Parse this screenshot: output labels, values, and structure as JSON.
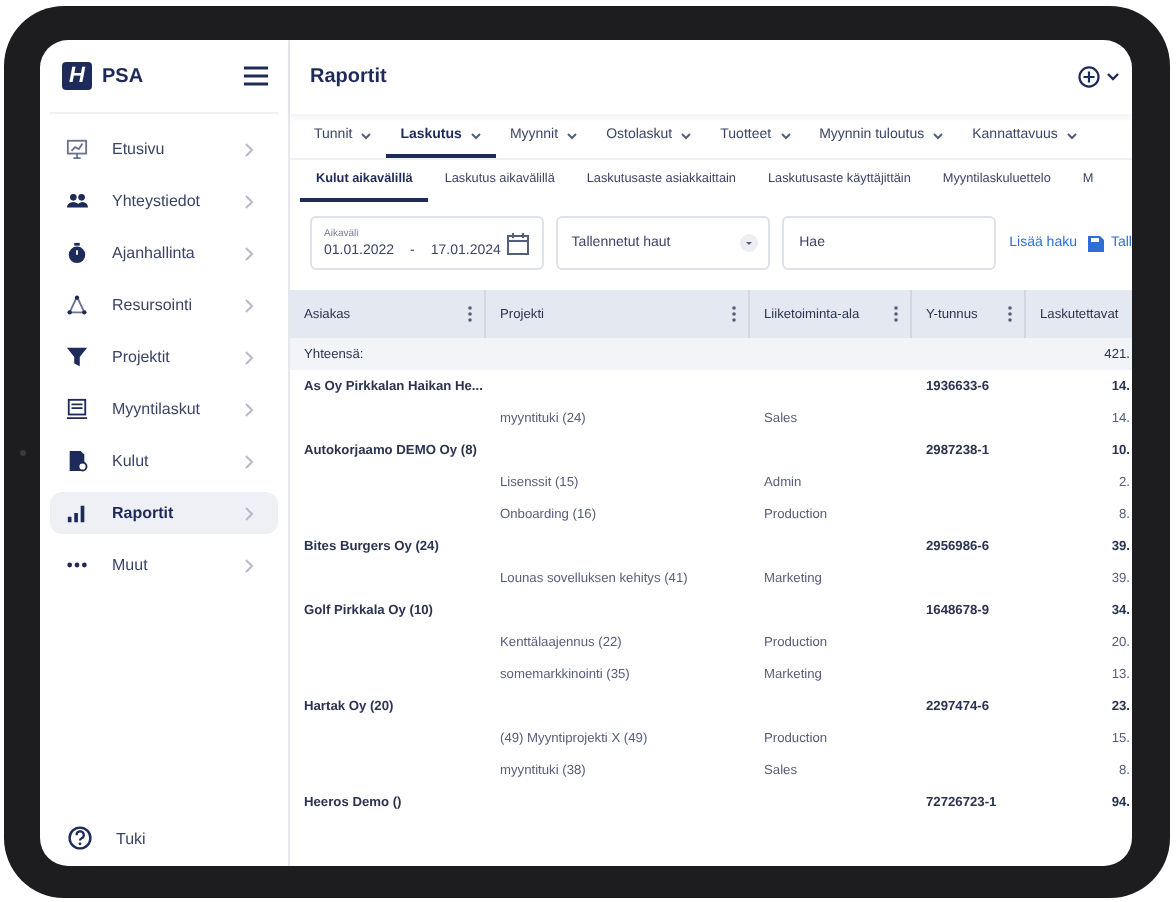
{
  "sidebar": {
    "logo_mark": "H",
    "brand": "PSA",
    "items": [
      {
        "label": "Etusivu",
        "selected": false
      },
      {
        "label": "Yhteystiedot",
        "selected": false
      },
      {
        "label": "Ajanhallinta",
        "selected": false
      },
      {
        "label": "Resursointi",
        "selected": false
      },
      {
        "label": "Projektit",
        "selected": false
      },
      {
        "label": "Myyntilaskut",
        "selected": false
      },
      {
        "label": "Kulut",
        "selected": false
      },
      {
        "label": "Raportit",
        "selected": true
      },
      {
        "label": "Muut",
        "selected": false
      }
    ],
    "help": "Tuki"
  },
  "header": {
    "title": "Raportit"
  },
  "tabs": [
    {
      "label": "Tunnit",
      "selected": false
    },
    {
      "label": "Laskutus",
      "selected": true
    },
    {
      "label": "Myynnit",
      "selected": false
    },
    {
      "label": "Ostolaskut",
      "selected": false
    },
    {
      "label": "Tuotteet",
      "selected": false
    },
    {
      "label": "Myynnin tuloutus",
      "selected": false
    },
    {
      "label": "Kannattavuus",
      "selected": false
    }
  ],
  "subtabs": [
    {
      "label": "Kulut aikavälillä",
      "selected": true
    },
    {
      "label": "Laskutus aikavälillä",
      "selected": false
    },
    {
      "label": "Laskutusaste asiakkaittain",
      "selected": false
    },
    {
      "label": "Laskutusaste käyttäjittäin",
      "selected": false
    },
    {
      "label": "Myyntilaskuluettelo",
      "selected": false
    },
    {
      "label": "M",
      "selected": false
    }
  ],
  "filters": {
    "date_range": {
      "label": "Aikaväli",
      "start": "01.01.2022",
      "separator": "-",
      "end": "17.01.2024"
    },
    "saved_searches": {
      "value": "Tallennetut haut"
    },
    "search": {
      "placeholder": "Hae"
    },
    "add_search": "Lisää haku",
    "save": "Tall"
  },
  "table": {
    "columns": [
      "Asiakas",
      "Projekti",
      "Liiketoiminta-ala",
      "Y-tunnus",
      "Laskutettavat"
    ],
    "rows": [
      {
        "kind": "total",
        "customer": "Yhteensä:",
        "value": "421."
      },
      {
        "kind": "customer",
        "customer": "As Oy Pirkkalan Haikan He...",
        "business_id": "1936633-6",
        "value": "14."
      },
      {
        "kind": "project",
        "project": "myyntituki (24)",
        "area": "Sales",
        "value": "14."
      },
      {
        "kind": "customer",
        "customer": "Autokorjaamo DEMO Oy (8)",
        "business_id": "2987238-1",
        "value": "10."
      },
      {
        "kind": "project",
        "project": "Lisenssit (15)",
        "area": "Admin",
        "value": "2."
      },
      {
        "kind": "project",
        "project": "Onboarding (16)",
        "area": "Production",
        "value": "8."
      },
      {
        "kind": "customer",
        "customer": "Bites Burgers Oy (24)",
        "business_id": "2956986-6",
        "value": "39."
      },
      {
        "kind": "project",
        "project": "Lounas sovelluksen kehitys (41)",
        "area": "Marketing",
        "value": "39."
      },
      {
        "kind": "customer",
        "customer": "Golf Pirkkala Oy (10)",
        "business_id": "1648678-9",
        "value": "34."
      },
      {
        "kind": "project",
        "project": "Kenttälaajennus (22)",
        "area": "Production",
        "value": "20."
      },
      {
        "kind": "project",
        "project": "somemarkkinointi (35)",
        "area": "Marketing",
        "value": "13."
      },
      {
        "kind": "customer",
        "customer": "Hartak Oy (20)",
        "business_id": "2297474-6",
        "value": "23."
      },
      {
        "kind": "project",
        "project": "(49) Myyntiprojekti X (49)",
        "area": "Production",
        "value": "15."
      },
      {
        "kind": "project",
        "project": "myyntituki (38)",
        "area": "Sales",
        "value": "8."
      },
      {
        "kind": "customer",
        "customer": "Heeros Demo ()",
        "business_id": "72726723-1",
        "value": "94."
      }
    ]
  }
}
